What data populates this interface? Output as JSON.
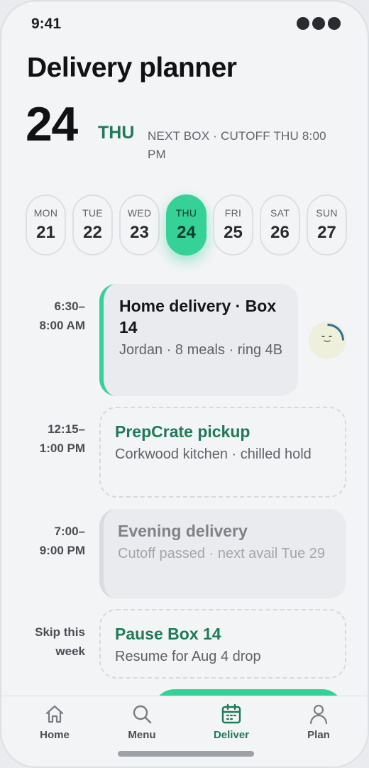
{
  "status_bar": {
    "time": "9:41"
  },
  "header": {
    "title": "Delivery planner",
    "date_number": "24",
    "day_name": "THU",
    "cutoff_text": "NEXT BOX · CUTOFF THU 8:00 PM"
  },
  "days": [
    {
      "name": "MON",
      "num": "21"
    },
    {
      "name": "TUE",
      "num": "22"
    },
    {
      "name": "WED",
      "num": "23"
    },
    {
      "name": "THU",
      "num": "24",
      "selected": true
    },
    {
      "name": "FRI",
      "num": "25"
    },
    {
      "name": "SAT",
      "num": "26"
    },
    {
      "name": "SUN",
      "num": "27"
    }
  ],
  "slots": {
    "home": {
      "time": "6:30–\n8:00 AM",
      "title": "Home delivery · Box 14",
      "sub": "Jordan · 8 meals · ring 4B"
    },
    "pickup": {
      "time": "12:15–\n1:00 PM",
      "title": "PrepCrate pickup",
      "sub": "Corkwood kitchen · chilled hold"
    },
    "evening": {
      "time": "7:00–\n9:00 PM",
      "title": "Evening delivery",
      "sub": "Cutoff passed · next avail Tue 29"
    },
    "pause": {
      "time": "Skip this\nweek",
      "title": "Pause Box 14",
      "sub": "Resume for Aug 4 drop"
    }
  },
  "nav": {
    "home": "Home",
    "menu": "Menu",
    "deliver": "Deliver",
    "plan": "Plan",
    "active": "deliver"
  },
  "colors": {
    "accent": "#36d197",
    "accent_text": "#1f7a57",
    "background": "#f3f4f6"
  }
}
